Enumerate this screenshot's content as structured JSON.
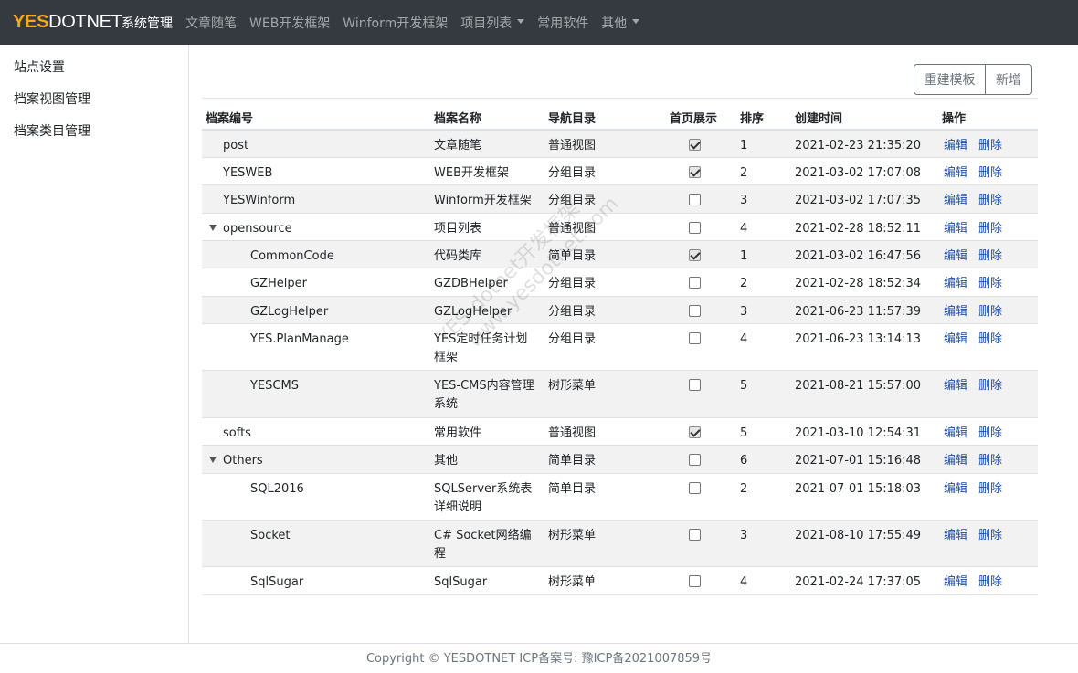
{
  "brand": {
    "part1": "YES",
    "part2": "DOTNET"
  },
  "nav": [
    {
      "label": "系统管理"
    },
    {
      "label": "文章随笔"
    },
    {
      "label": "WEB开发框架"
    },
    {
      "label": "Winform开发框架"
    },
    {
      "label": "项目列表"
    },
    {
      "label": "常用软件"
    },
    {
      "label": "其他"
    }
  ],
  "sidebar": [
    {
      "label": "站点设置"
    },
    {
      "label": "档案视图管理"
    },
    {
      "label": "档案类目管理"
    }
  ],
  "toolbar": {
    "rebuild": "重建模板",
    "add": "新增"
  },
  "table": {
    "headers": [
      "档案编号",
      "档案名称",
      "导航目录",
      "首页展示",
      "排序",
      "创建时间",
      "操作"
    ],
    "edit_label": "编辑",
    "delete_label": "删除",
    "rows": [
      {
        "code": "post",
        "name": "文章随笔",
        "nav": "普通视图",
        "home": true,
        "order": "1",
        "created": "2021-02-23 21:35:20"
      },
      {
        "code": "YESWEB",
        "name": "WEB开发框架",
        "nav": "分组目录",
        "home": true,
        "order": "2",
        "created": "2021-03-02 17:07:08"
      },
      {
        "code": "YESWinform",
        "name": "Winform开发框架",
        "nav": "分组目录",
        "home": false,
        "order": "3",
        "created": "2021-03-02 17:07:35"
      },
      {
        "code": "opensource",
        "name": "项目列表",
        "nav": "普通视图",
        "home": false,
        "order": "4",
        "created": "2021-02-28 18:52:11"
      },
      {
        "code": "CommonCode",
        "name": "代码类库",
        "nav": "简单目录",
        "home": true,
        "order": "1",
        "created": "2021-03-02 16:47:56"
      },
      {
        "code": "GZHelper",
        "name": "GZDBHelper",
        "nav": "分组目录",
        "home": false,
        "order": "2",
        "created": "2021-02-28 18:52:34"
      },
      {
        "code": "GZLogHelper",
        "name": "GZLogHelper",
        "nav": "分组目录",
        "home": false,
        "order": "3",
        "created": "2021-06-23 11:57:39"
      },
      {
        "code": "YES.PlanManage",
        "name": "YES定时任务计划框架",
        "nav": "分组目录",
        "home": false,
        "order": "4",
        "created": "2021-06-23 13:14:13"
      },
      {
        "code": "YESCMS",
        "name": "YES-CMS内容管理系统",
        "nav": "树形菜单",
        "home": false,
        "order": "5",
        "created": "2021-08-21 15:57:00"
      },
      {
        "code": "softs",
        "name": "常用软件",
        "nav": "普通视图",
        "home": true,
        "order": "5",
        "created": "2021-03-10 12:54:31"
      },
      {
        "code": "Others",
        "name": "其他",
        "nav": "简单目录",
        "home": false,
        "order": "6",
        "created": "2021-07-01 15:16:48"
      },
      {
        "code": "SQL2016",
        "name": "SQLServer系统表详细说明",
        "nav": "简单目录",
        "home": false,
        "order": "2",
        "created": "2021-07-01 15:18:03"
      },
      {
        "code": "Socket",
        "name": "C# Socket网络编程",
        "nav": "树形菜单",
        "home": false,
        "order": "3",
        "created": "2021-08-10 17:55:49"
      },
      {
        "code": "SqlSugar",
        "name": "SqlSugar",
        "nav": "树形菜单",
        "home": false,
        "order": "4",
        "created": "2021-02-24 17:37:05"
      }
    ]
  },
  "footer": "Copyright © YESDOTNET ICP备案号: 豫ICP备2021007859号",
  "watermark": {
    "line1": "YES-dotnet开发框架",
    "line2": "www.yesdotnet.com"
  }
}
